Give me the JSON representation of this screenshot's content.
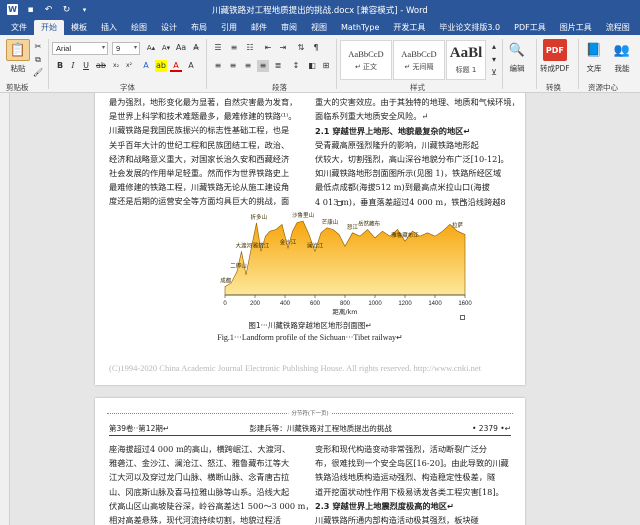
{
  "titlebar": {
    "title": "川藏铁路对工程地质提出的挑战.docx [兼容模式] - Word",
    "bg": "#2b579a"
  },
  "tabs": [
    "文件",
    "开始",
    "模板",
    "插入",
    "绘图",
    "设计",
    "布局",
    "引用",
    "邮件",
    "审阅",
    "视图",
    "MathType",
    "开发工具",
    "毕业论文排版3.0",
    "PDF工具",
    "图片工具",
    "流程图",
    "百度网"
  ],
  "ribbon": {
    "paste": "粘贴",
    "clipboard": "剪贴板",
    "font_name": "Arial",
    "font_size": "9",
    "font_group": "字体",
    "paragraph_group": "段落",
    "styles": [
      {
        "preview": "AaBbCcD",
        "name": "↵ 正文"
      },
      {
        "preview": "AaBbCcD",
        "name": "↵ 无间隔"
      },
      {
        "preview": "AaBl",
        "name": "标题 1"
      }
    ],
    "styles_group": "样式",
    "edit": "编辑",
    "to_pdf": "转成PDF",
    "convert_group": "转换",
    "library": "文库",
    "search": "我能",
    "resources_group": "资源中心"
  },
  "doc": {
    "page1_left": [
      "最为强烈，地形变化最为显著，自然灾害最为发育，",
      "是世界上科学和技术难题最多，最难修建的铁路⁽¹⁾。",
      "川藏铁路是我国民族振兴的标志性基础工程，也是",
      "关乎百年大计的世纪工程和民族团结工程，政治、",
      "经济和战略意义重大，对国家长治久安和西藏经济",
      "社会发展的作用举足轻重。然而作为世界铁路史上",
      "最难修建的铁路工程，川藏铁路无论从施工建设角",
      "度还是后期的运营安全等方面均具巨大的挑战，面"
    ],
    "page1_right": [
      "发，且具有新构造运动强烈、地震活动强烈、山地灾害",
      "重大的灾害效应。由于其独特的地理、地质和气候环境，",
      "面临系列重大地质安全风险。↵",
      "2.1 穿越世界上地形、地貌最复杂的地区↵",
      "受青藏高原强烈隆升的影响，川藏铁路地形起",
      "伏较大，切割强烈，高山深谷地貌分布广泛[10-12]。",
      "如川藏铁路地形剖面图所示(见图 1)，铁路所经区域",
      "最低点成都(海拔512 m)到最高点米拉山口(海拔",
      "4 013 m)，垂直落差超过4 000 m，铁路沿线跨越8"
    ],
    "caption_cn": "图1···川藏铁路穿越地区地形剖面图↵",
    "caption_en": "Fig.1···Landform profile of the Sichuan···Tibet railway↵",
    "copyright": "(C)1994-2020 China Academic Journal Electronic Publishing House. All rights reserved.    http://www.cnki.net",
    "section_break": "分节符(下一页)",
    "running_head": {
      "left": "第39卷··第12期↵",
      "center": "彭建兵等：川藏铁路对工程地质提出的挑战",
      "right": "• 2379 •↵"
    },
    "page2_left": [
      "座海拔超过4 000 m的高山，横跨岷江、大渡河、",
      "雅砻江、金沙江、澜沧江、怒江、雅鲁藏布江等大",
      "江大河以及穿过龙门山脉、横断山脉、念青唐古拉",
      "山、冈底斯山脉及喜马拉雅山脉等山系。沿线大起",
      "伏高山区山高坡陡谷深，岭谷高差达1 500～3 000 m，",
      "相对高差悬殊，现代河流持续切割，地貌过程活"
    ],
    "page2_right": [
      "变形和现代构造变动非常强烈，活动断裂广泛分",
      "布，很难找到一个安全岛区[16-20]。由此导致的川藏",
      "铁路沿线地质构造运动强烈、构造稳定性极差，隧",
      "道开挖面状动性作用下极易诱发各类工程灾害[18]。",
      "2.3 穿越世界上地震烈度极高的地区↵",
      "川藏铁路所通内部构造活动极其强烈，板块碰"
    ]
  },
  "chart_data": {
    "type": "area",
    "title": "",
    "xlabel": "距离/km",
    "ylabel": "",
    "x_ticks": [
      0,
      200,
      400,
      600,
      800,
      1000,
      1200,
      1400,
      1600
    ],
    "xlim": [
      0,
      1600
    ],
    "ylim": [
      0,
      5000
    ],
    "stations": [
      {
        "name": "成都",
        "x": 5
      },
      {
        "name": "大渡河",
        "x": 125
      },
      {
        "name": "二郎山",
        "x": 90
      },
      {
        "name": "折多山",
        "x": 225
      },
      {
        "name": "雅砻江",
        "x": 240
      },
      {
        "name": "金沙江",
        "x": 420
      },
      {
        "name": "沙鲁里山",
        "x": 520
      },
      {
        "name": "澜沧江",
        "x": 600
      },
      {
        "name": "芒康山",
        "x": 700
      },
      {
        "name": "怒江",
        "x": 850
      },
      {
        "name": "岳然藏布",
        "x": 960
      },
      {
        "name": "雅鲁藏布江",
        "x": 1200
      },
      {
        "name": "拉萨",
        "x": 1550
      }
    ],
    "profile_x": [
      0,
      40,
      80,
      110,
      140,
      180,
      210,
      240,
      270,
      300,
      340,
      380,
      420,
      450,
      480,
      520,
      560,
      600,
      640,
      680,
      720,
      760,
      800,
      850,
      900,
      950,
      1000,
      1050,
      1100,
      1150,
      1200,
      1250,
      1300,
      1350,
      1400,
      1450,
      1500,
      1550,
      1600
    ],
    "profile_y": [
      500,
      700,
      1400,
      2600,
      1200,
      3000,
      4300,
      2600,
      3500,
      3800,
      3900,
      4200,
      2800,
      3800,
      4300,
      4400,
      3600,
      2600,
      3700,
      4000,
      3900,
      3600,
      2900,
      3700,
      3500,
      3900,
      3400,
      3800,
      3500,
      3900,
      3200,
      3800,
      3500,
      3700,
      3500,
      3800,
      4200,
      3800,
      3600
    ],
    "fill_colors": [
      "#f7a50c",
      "#fde89a"
    ]
  }
}
